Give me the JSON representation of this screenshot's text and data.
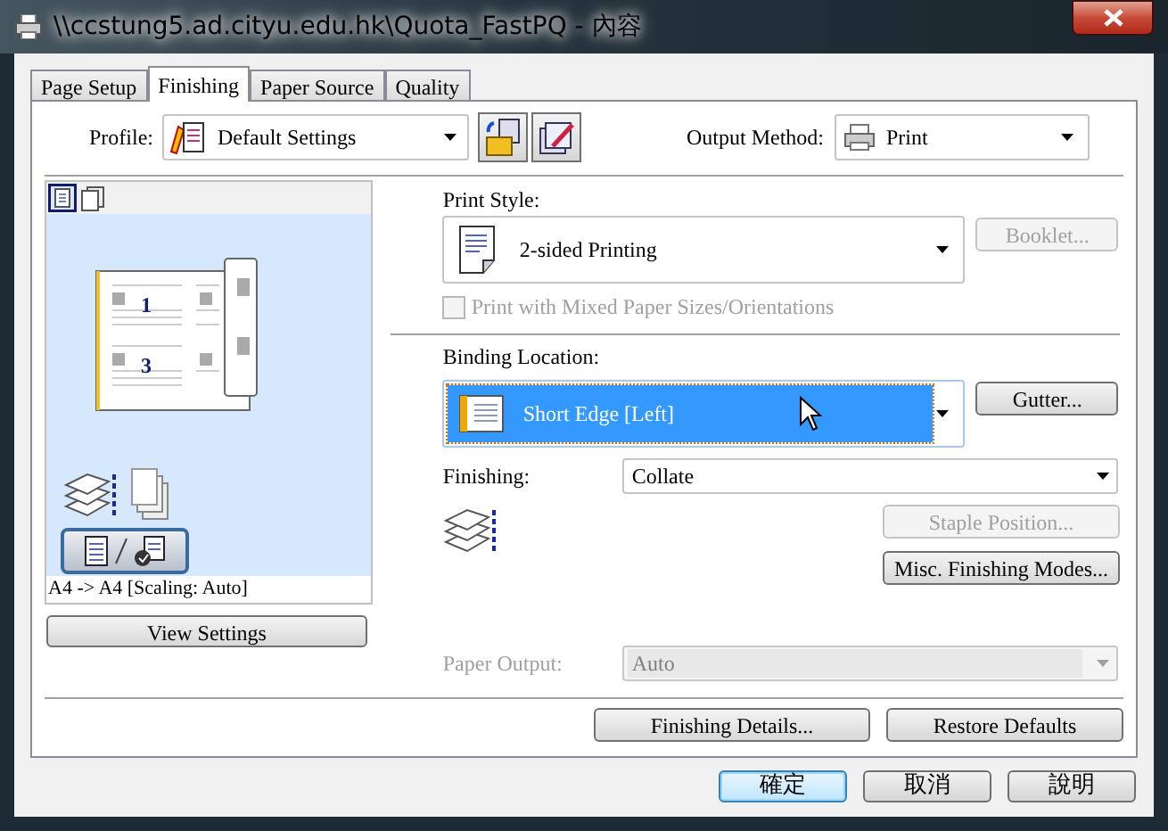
{
  "window": {
    "title": "\\\\ccstung5.ad.cityu.edu.hk\\Quota_FastPQ - 內容"
  },
  "tabs": [
    {
      "label": "Page Setup",
      "selected": false
    },
    {
      "label": "Finishing",
      "selected": true
    },
    {
      "label": "Paper Source",
      "selected": false
    },
    {
      "label": "Quality",
      "selected": false
    }
  ],
  "profile": {
    "label": "Profile:",
    "value": "Default Settings"
  },
  "output_method": {
    "label": "Output Method:",
    "value": "Print"
  },
  "preview": {
    "view_modes": [
      {
        "selected": true
      },
      {
        "selected": false
      }
    ],
    "page_numbers": [
      "1",
      "3"
    ],
    "caption": "A4 -> A4 [Scaling: Auto]"
  },
  "view_settings_button": {
    "label": "View Settings",
    "disabled": false
  },
  "print_style": {
    "label": "Print Style:",
    "value": "2-sided Printing"
  },
  "booklet_button": {
    "label": "Booklet...",
    "disabled": true
  },
  "mixed_paper": {
    "label": "Print with Mixed Paper Sizes/Orientations",
    "checked": false,
    "disabled": true
  },
  "binding_location": {
    "label": "Binding Location:",
    "value": "Short Edge [Left]",
    "selected": true
  },
  "gutter_button": {
    "label": "Gutter...",
    "disabled": false
  },
  "finishing": {
    "label": "Finishing:",
    "value": "Collate"
  },
  "staple_position_button": {
    "label": "Staple Position...",
    "disabled": true
  },
  "misc_button": {
    "label": "Misc. Finishing Modes...",
    "disabled": false
  },
  "paper_output": {
    "label": "Paper Output:",
    "value": "Auto",
    "disabled": true
  },
  "panel_buttons": [
    {
      "label": "Finishing Details...",
      "disabled": false
    },
    {
      "label": "Restore Defaults",
      "disabled": false
    }
  ],
  "dialog_buttons": [
    {
      "label": "確定",
      "default": true
    },
    {
      "label": "取消",
      "default": false
    },
    {
      "label": "說明",
      "default": false
    }
  ]
}
